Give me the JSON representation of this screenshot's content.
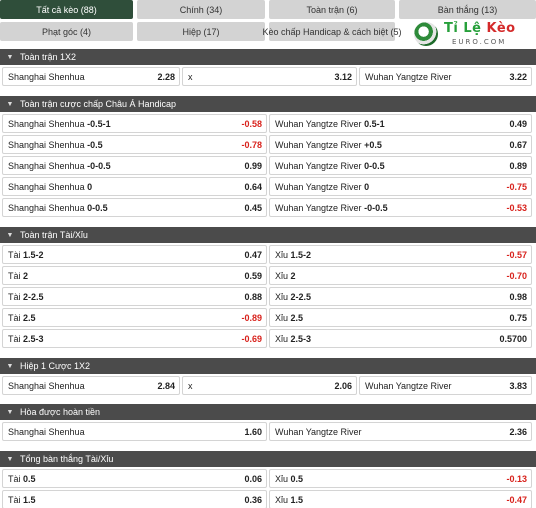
{
  "tabs": [
    {
      "label": "Tất cả kèo (88)"
    },
    {
      "label": "Chính (34)"
    },
    {
      "label": "Toàn trận (6)"
    },
    {
      "label": "Bàn thắng (13)"
    },
    {
      "label": "Phạt góc (4)"
    },
    {
      "label": "Hiệp (17)"
    },
    {
      "label": "Kèo chấp Handicap & cách biệt (5)"
    }
  ],
  "logo": {
    "main_a": "Tỉ Lệ ",
    "main_b": "Kèo",
    "sub": "EURO.COM"
  },
  "colors": {
    "header_bg": "#4b4b4b",
    "active_tab": "#2f4e3a",
    "negative": "#d8221c"
  },
  "sections": [
    {
      "title": "Toàn trận 1X2",
      "rows": [
        [
          {
            "name": "Shanghai Shenhua",
            "line": "",
            "value": "2.28"
          },
          {
            "name": "x",
            "line": "",
            "value": "3.12"
          },
          {
            "name": "Wuhan Yangtze River",
            "line": "",
            "value": "3.22"
          }
        ]
      ]
    },
    {
      "title": "Toàn trận cược chấp Châu Á Handicap",
      "rows": [
        [
          {
            "name": "Shanghai Shenhua",
            "line": "-0.5-1",
            "value": "-0.58"
          },
          {
            "name": "Wuhan Yangtze River",
            "line": "0.5-1",
            "value": "0.49"
          }
        ],
        [
          {
            "name": "Shanghai Shenhua",
            "line": "-0.5",
            "value": "-0.78"
          },
          {
            "name": "Wuhan Yangtze River",
            "line": "+0.5",
            "value": "0.67"
          }
        ],
        [
          {
            "name": "Shanghai Shenhua",
            "line": "-0-0.5",
            "value": "0.99"
          },
          {
            "name": "Wuhan Yangtze River",
            "line": "0-0.5",
            "value": "0.89"
          }
        ],
        [
          {
            "name": "Shanghai Shenhua",
            "line": "0",
            "value": "0.64"
          },
          {
            "name": "Wuhan Yangtze River",
            "line": "0",
            "value": "-0.75"
          }
        ],
        [
          {
            "name": "Shanghai Shenhua",
            "line": "0-0.5",
            "value": "0.45"
          },
          {
            "name": "Wuhan Yangtze River",
            "line": "-0-0.5",
            "value": "-0.53"
          }
        ]
      ]
    },
    {
      "title": "Toàn trận Tài/Xỉu",
      "rows": [
        [
          {
            "name": "Tài",
            "line": "1.5-2",
            "value": "0.47"
          },
          {
            "name": "Xỉu",
            "line": "1.5-2",
            "value": "-0.57"
          }
        ],
        [
          {
            "name": "Tài",
            "line": "2",
            "value": "0.59"
          },
          {
            "name": "Xỉu",
            "line": "2",
            "value": "-0.70"
          }
        ],
        [
          {
            "name": "Tài",
            "line": "2-2.5",
            "value": "0.88"
          },
          {
            "name": "Xỉu",
            "line": "2-2.5",
            "value": "0.98"
          }
        ],
        [
          {
            "name": "Tài",
            "line": "2.5",
            "value": "-0.89"
          },
          {
            "name": "Xỉu",
            "line": "2.5",
            "value": "0.75"
          }
        ],
        [
          {
            "name": "Tài",
            "line": "2.5-3",
            "value": "-0.69"
          },
          {
            "name": "Xỉu",
            "line": "2.5-3",
            "value": "0.5700"
          }
        ]
      ]
    },
    {
      "title": "Hiệp 1 Cược 1X2",
      "rows": [
        [
          {
            "name": "Shanghai Shenhua",
            "line": "",
            "value": "2.84"
          },
          {
            "name": "x",
            "line": "",
            "value": "2.06"
          },
          {
            "name": "Wuhan Yangtze River",
            "line": "",
            "value": "3.83"
          }
        ]
      ]
    },
    {
      "title": "Hòa được hoàn tiền",
      "rows": [
        [
          {
            "name": "Shanghai Shenhua",
            "line": "",
            "value": "1.60"
          },
          {
            "name": "Wuhan Yangtze River",
            "line": "",
            "value": "2.36"
          }
        ]
      ]
    },
    {
      "title": "Tổng bàn thắng Tài/Xỉu",
      "rows": [
        [
          {
            "name": "Tài",
            "line": "0.5",
            "value": "0.06"
          },
          {
            "name": "Xỉu",
            "line": "0.5",
            "value": "-0.13"
          }
        ],
        [
          {
            "name": "Tài",
            "line": "1.5",
            "value": "0.36"
          },
          {
            "name": "Xỉu",
            "line": "1.5",
            "value": "-0.47"
          }
        ]
      ]
    }
  ]
}
